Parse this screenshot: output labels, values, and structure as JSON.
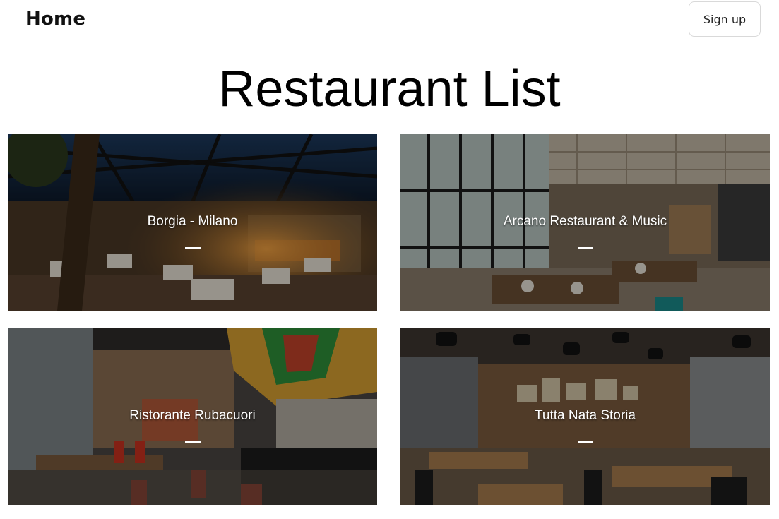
{
  "header": {
    "home_label": "Home",
    "signup_label": "Sign up"
  },
  "page": {
    "title": "Restaurant List"
  },
  "restaurants": [
    {
      "name": "Borgia - Milano"
    },
    {
      "name": "Arcano Restaurant & Music"
    },
    {
      "name": "Ristorante Rubacuori"
    },
    {
      "name": "Tutta Nata Storia"
    }
  ],
  "colors": {
    "background": "#ffffff",
    "header_rule": "#6b6b6b",
    "overlay_text": "#ffffff"
  }
}
